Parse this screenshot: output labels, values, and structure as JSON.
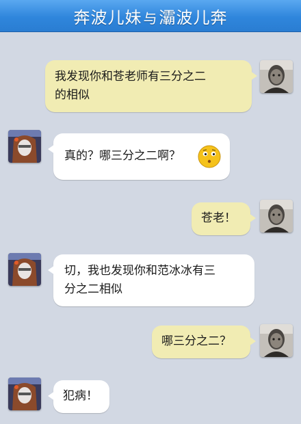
{
  "header": {
    "title_left": "奔波儿妹",
    "title_mid": "与",
    "title_right": "灞波儿奔"
  },
  "messages": [
    {
      "side": "right",
      "line1": "我发现你和苍老师有三分之二",
      "line2": "的相似"
    },
    {
      "side": "left",
      "text": "真的？哪三分之二啊？",
      "emoji": "thinking-face-icon"
    },
    {
      "side": "right",
      "text": "苍老！"
    },
    {
      "side": "left",
      "line1": "切，我也发现你和范冰冰有三",
      "line2": "分之二相似"
    },
    {
      "side": "right",
      "text": "哪三分之二？"
    },
    {
      "side": "left",
      "text": "犯病！"
    }
  ],
  "colors": {
    "background": "#d2d8e3",
    "header": "#2f86dc",
    "right_bubble": "#f1ecb3",
    "left_bubble": "#ffffff"
  }
}
